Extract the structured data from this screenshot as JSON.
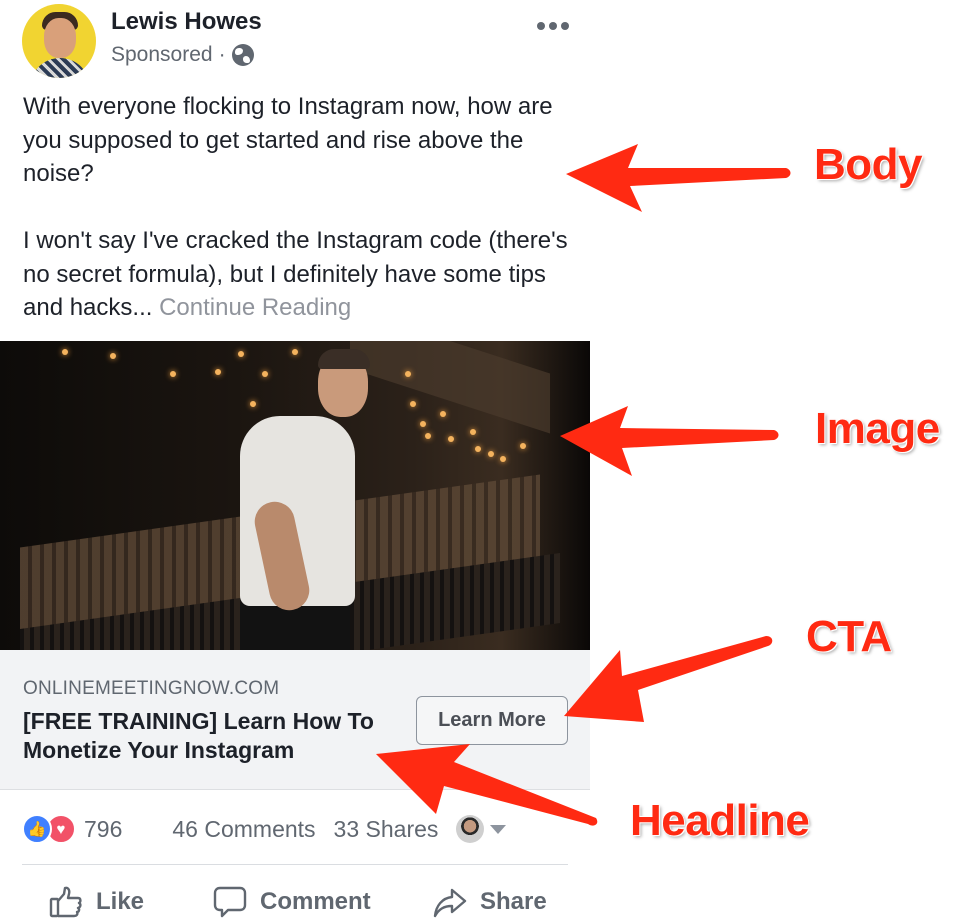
{
  "post": {
    "author": "Lewis Howes",
    "meta_label": "Sponsored",
    "meta_separator": "·",
    "audience_icon": "globe-icon",
    "more_icon": "more-options-icon",
    "body_paragraphs": [
      "With everyone flocking to Instagram now, how are you supposed to get started and rise above the noise?",
      "I won't say I've cracked the Instagram code (there's no secret formula), but I definitely have some tips and hacks..."
    ],
    "continue_label": "Continue Reading"
  },
  "link_preview": {
    "domain": "ONLINEMEETINGNOW.COM",
    "headline": "[FREE TRAINING] Learn How To Monetize Your Instagram",
    "cta_label": "Learn More",
    "background": "#f2f3f5"
  },
  "stats": {
    "reactions": [
      "like",
      "love"
    ],
    "reaction_colors": {
      "like": "#4080ff",
      "love": "#f25268"
    },
    "reaction_count": "796",
    "comments": "46 Comments",
    "shares": "33 Shares"
  },
  "actions": [
    {
      "label": "Like",
      "icon": "thumbs-up-icon"
    },
    {
      "label": "Comment",
      "icon": "comment-bubble-icon"
    },
    {
      "label": "Share",
      "icon": "share-arrow-icon"
    }
  ],
  "annotations": {
    "color": "#ff2a12",
    "labels": [
      "Body",
      "Image",
      "CTA",
      "Headline"
    ]
  }
}
